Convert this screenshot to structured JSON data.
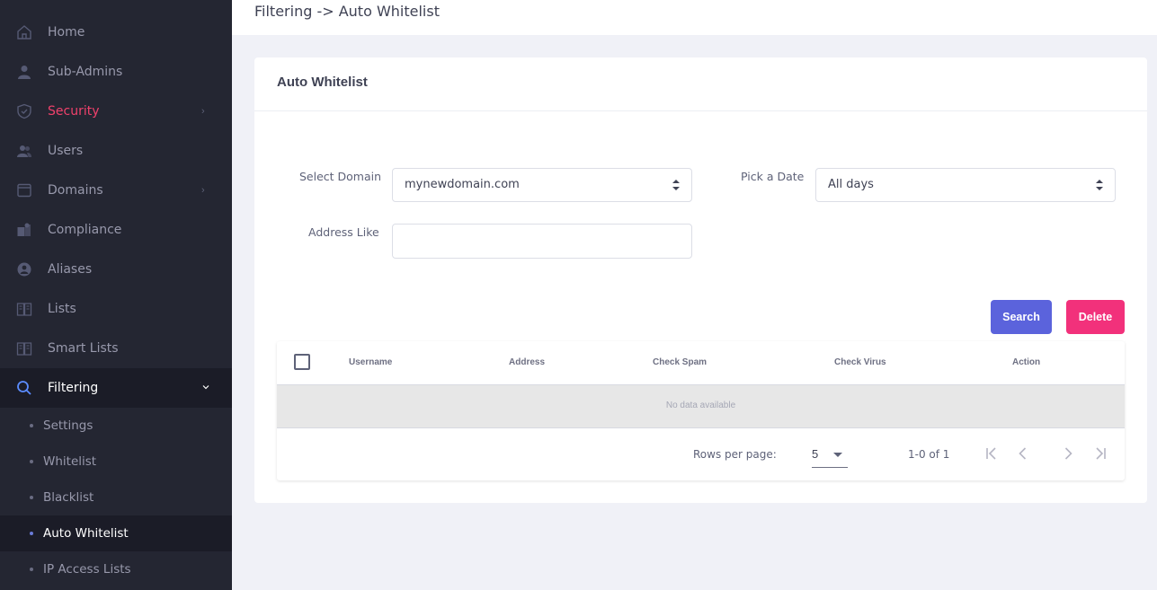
{
  "sidebar": {
    "items": [
      {
        "label": "Home",
        "icon": "home-icon"
      },
      {
        "label": "Sub-Admins",
        "icon": "user-icon"
      },
      {
        "label": "Security",
        "icon": "shield-icon"
      },
      {
        "label": "Users",
        "icon": "users-icon"
      },
      {
        "label": "Domains",
        "icon": "window-icon"
      },
      {
        "label": "Compliance",
        "icon": "compliance-icon"
      },
      {
        "label": "Aliases",
        "icon": "aliases-icon"
      },
      {
        "label": "Lists",
        "icon": "book-icon"
      },
      {
        "label": "Smart Lists",
        "icon": "book-icon"
      },
      {
        "label": "Filtering",
        "icon": "search-icon"
      }
    ],
    "filtering_sub": [
      {
        "label": "Settings"
      },
      {
        "label": "Whitelist"
      },
      {
        "label": "Blacklist"
      },
      {
        "label": "Auto Whitelist"
      },
      {
        "label": "IP Access Lists"
      }
    ],
    "accent_color": "#f1416c"
  },
  "header": {
    "breadcrumb": "Filtering -> Auto Whitelist"
  },
  "card": {
    "title": "Auto Whitelist",
    "form": {
      "domain_label": "Select Domain",
      "domain_value": "mynewdomain.com",
      "date_label": "Pick a Date",
      "date_value": "All days",
      "address_label": "Address Like",
      "address_value": "",
      "search_label": "Search",
      "delete_label": "Delete"
    },
    "table": {
      "columns": [
        "Username",
        "Address",
        "Check Spam",
        "Check Virus",
        "Action"
      ],
      "empty_text": "No data available",
      "rows_per_page_label": "Rows per page:",
      "rows_per_page_value": "5",
      "range_text": "1-0 of 1"
    }
  }
}
